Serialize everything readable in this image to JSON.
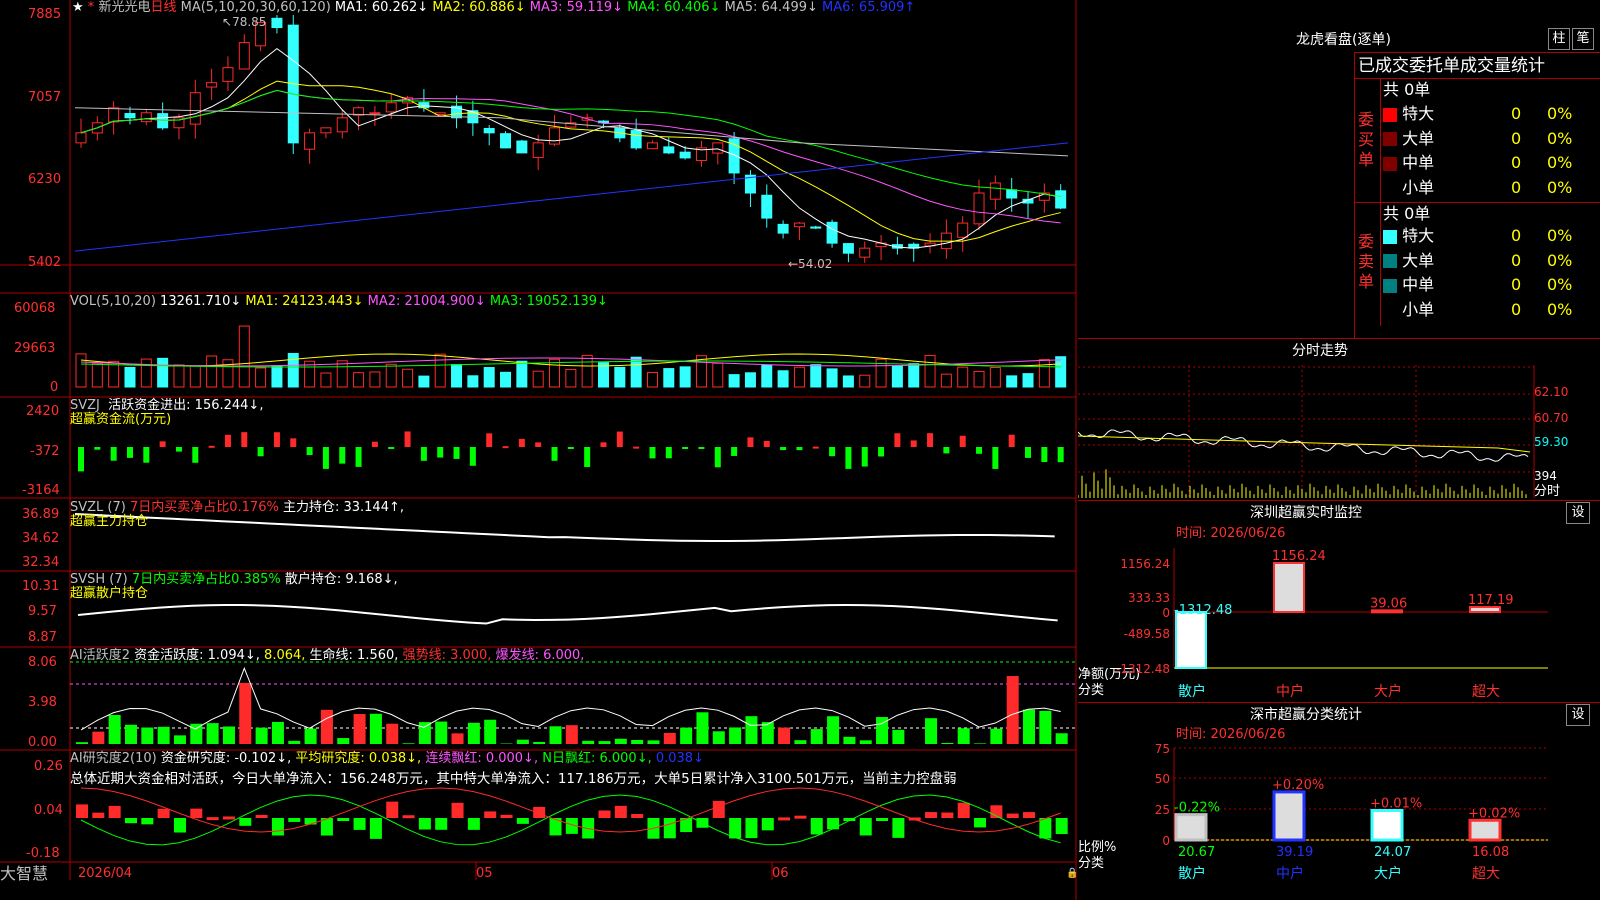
{
  "colors": {
    "up": "#ff2a2a",
    "down": "#33ffff",
    "grid": "#b00000",
    "green": "#00ff00",
    "yellow": "#ffff00",
    "magenta": "#ff55ff",
    "white": "#ffffff",
    "blue": "#2233ff",
    "darkred": "#800000",
    "teal": "#008080"
  },
  "main": {
    "stock_name": "新光光电",
    "period": "日线",
    "ma_params": "MA(5,10,20,30,60,120)",
    "ma1": "MA1: 60.262↓",
    "ma2": "MA2: 60.886↓",
    "ma3": "MA3: 59.119↓",
    "ma4": "MA4: 60.406↓",
    "ma5": "MA5: 64.499↓",
    "ma6": "MA6: 65.909↑",
    "high_mark": "78.85",
    "low_mark": "←54.02",
    "y_ticks": [
      "78853",
      "7057",
      "6230",
      "5402"
    ],
    "y_ticks_display": [
      "7885",
      "7057",
      "6230",
      "5402"
    ]
  },
  "vol": {
    "title": "VOL(5,10,20)",
    "value": "13261.710↓",
    "ma1": "MA1: 24123.443↓",
    "ma2": "MA2: 21004.900↓",
    "ma3": "MA3: 19052.139↓",
    "y_ticks": [
      "60068",
      "29663",
      "0"
    ]
  },
  "svzj": {
    "title": "SVZJ",
    "label": "活跃资金进出: 156.244↓,",
    "sub": "超赢资金流(万元)",
    "y_ticks": [
      "2420",
      "-372",
      "-3164"
    ]
  },
  "svzl": {
    "title": "SVZL (7)",
    "ratio": "7日内买卖净占比0.176%",
    "hold": "主力持仓: 33.144↑,",
    "sub": "超赢主力持仓",
    "y_ticks": [
      "36.89",
      "34.62",
      "32.34"
    ]
  },
  "svsh": {
    "title": "SVSH (7)",
    "ratio": "7日内买卖净占比0.385%",
    "hold": "散户持仓: 9.168↓,",
    "sub": "超赢散户持仓",
    "y_ticks": [
      "10.31",
      "9.57",
      "8.87"
    ]
  },
  "ai_active": {
    "title": "AI活跃度2",
    "a1": "资金活跃度: 1.094↓,",
    "a2": "8.064,",
    "a3": "生命线: 1.560,",
    "a4": "强势线: 3.000,",
    "a5": "爆发线: 6.000,",
    "y_ticks": [
      "8.06",
      "3.98",
      "0.00"
    ]
  },
  "ai_research": {
    "title": "AI研究度2(10)",
    "a1": "资金研究度: -0.102↓,",
    "a2": "平均研究度: 0.038↓,",
    "a3": "连续飘红: 0.000↓,",
    "a4": "N日飘红: 6.000↓,",
    "a5": "0.038↓",
    "summary": "总体近期大资金相对活跃，今日大单净流入：156.248万元，其中特大单净流入：117.186万元，大单5日累计净入3100.501万元，当前主力控盘弱",
    "y_ticks": [
      "0.26",
      "0.04",
      "-0.18"
    ]
  },
  "xaxis": {
    "d1": "2026/04",
    "d2": "05",
    "d3": "06"
  },
  "footer": {
    "brand": "大智慧"
  },
  "right": {
    "dragon_title": "龙虎看盘(逐单)",
    "btn1": "柱",
    "btn2": "笔",
    "stat_title": "已成交委托单成交量统计",
    "buy_side": "委买单",
    "sell_side": "委卖单",
    "buy_total": "共 0单",
    "sell_total": "共 0单",
    "rows_buy": [
      {
        "label": "特大",
        "count": "0",
        "pct": "0%",
        "color": "#ff0000"
      },
      {
        "label": "大单",
        "count": "0",
        "pct": "0%",
        "color": "#800000"
      },
      {
        "label": "中单",
        "count": "0",
        "pct": "0%",
        "color": "#800000"
      },
      {
        "label": "小单",
        "count": "0",
        "pct": "0%",
        "color": "#000000"
      }
    ],
    "rows_sell": [
      {
        "label": "特大",
        "count": "0",
        "pct": "0%",
        "color": "#33ffff"
      },
      {
        "label": "大单",
        "count": "0",
        "pct": "0%",
        "color": "#008080"
      },
      {
        "label": "中单",
        "count": "0",
        "pct": "0%",
        "color": "#008080"
      },
      {
        "label": "小单",
        "count": "0",
        "pct": "0%",
        "color": "#000000"
      }
    ],
    "fenshi_title": "分时走势",
    "fenshi_ticks": [
      "62.10",
      "60.70",
      "59.30"
    ],
    "fenshi_vol": "394",
    "fenshi_label": "分时",
    "sz_title": "深圳超赢实时监控",
    "set": "设",
    "time1": "时间: 2026/06/26",
    "sz_ticks": [
      "1156.24",
      "333.33",
      "0",
      "-489.58",
      "-1312.48"
    ],
    "sz_values": [
      {
        "cat": "散户",
        "val": "-1312.48"
      },
      {
        "cat": "中户",
        "val": "1156.24"
      },
      {
        "cat": "大户",
        "val": "39.06"
      },
      {
        "cat": "超大",
        "val": "117.19"
      }
    ],
    "net_label": "净额(万元)",
    "cls_label": "分类",
    "cls_title": "深市超赢分类统计",
    "time2": "时间: 2026/06/26",
    "cls_ticks": [
      "75",
      "50",
      "25",
      "0"
    ],
    "cls_values": [
      {
        "cat": "散户",
        "pct": "20.67",
        "chg": "-0.22%"
      },
      {
        "cat": "中户",
        "pct": "39.19",
        "chg": "+0.20%"
      },
      {
        "cat": "大户",
        "pct": "24.07",
        "chg": "+0.01%"
      },
      {
        "cat": "超大",
        "pct": "16.08",
        "chg": "+0.02%"
      }
    ],
    "ratio_label": "比例%",
    "cls_label2": "分类"
  }
}
